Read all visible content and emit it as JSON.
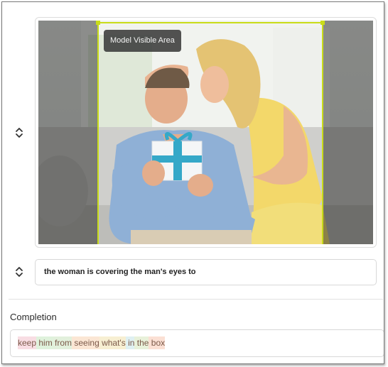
{
  "image_panel": {
    "visible_area_label": "Model Visible Area",
    "photo_icon": "couple-gift-photo"
  },
  "prompt": {
    "text": "the woman is covering the man's eyes to"
  },
  "completion": {
    "heading": "Completion",
    "tokens": [
      {
        "text": "keep",
        "color": "#f8dde3"
      },
      {
        "text": " him",
        "color": "#dff2dc"
      },
      {
        "text": " from",
        "color": "#e2f0dc"
      },
      {
        "text": " seeing",
        "color": "#fbe6d4"
      },
      {
        "text": " what's",
        "color": "#f7efd2"
      },
      {
        "text": " in",
        "color": "#dff0f2"
      },
      {
        "text": " the",
        "color": "#e8f1da"
      },
      {
        "text": " box",
        "color": "#fbe0d4"
      }
    ]
  },
  "icons": {
    "handle": "chevron-up-down-icon"
  }
}
